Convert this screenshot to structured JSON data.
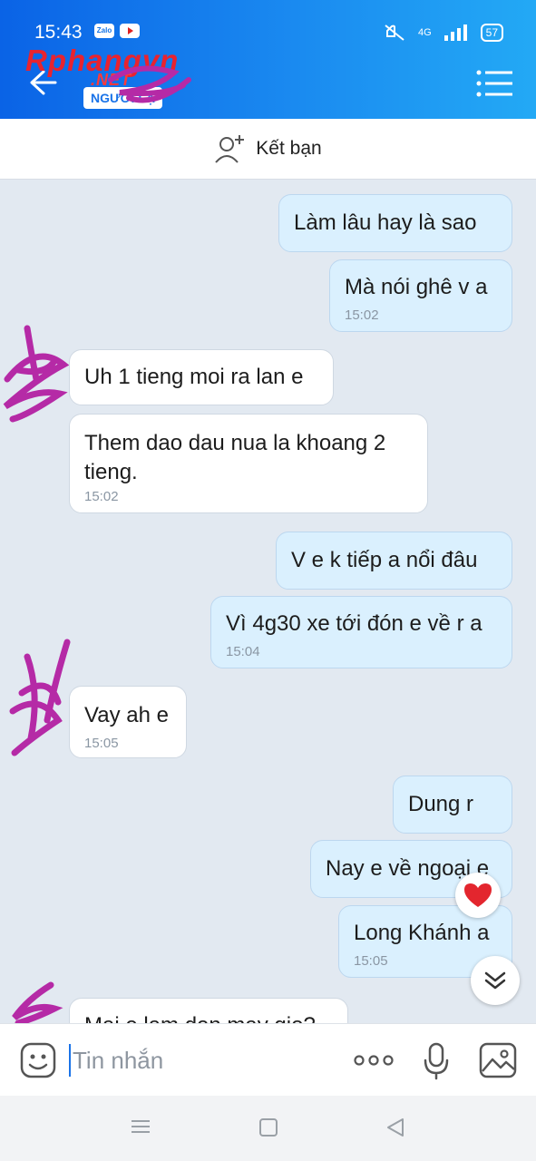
{
  "status": {
    "time": "15:43",
    "app1": "Zalo",
    "network": "4G",
    "battery": "57"
  },
  "header": {
    "brand": "Rphangvn",
    "brand_suffix": ".NET",
    "badge": "NGƯỜI LẠ"
  },
  "friend_bar": {
    "label": "Kết bạn"
  },
  "messages": [
    {
      "dir": "out",
      "text": "Làm lâu hay là sao",
      "time": ""
    },
    {
      "dir": "out",
      "text": "Mà nói ghê v a",
      "time": "15:02"
    },
    {
      "dir": "in",
      "text": "Uh 1 tieng moi ra lan e",
      "time": ""
    },
    {
      "dir": "in",
      "text": "Them dao dau nua la khoang 2 tieng.",
      "line1": "Them dao dau nua la khoang 2",
      "line2": "tieng.",
      "time": "15:02"
    },
    {
      "dir": "out",
      "text": "V e k tiếp a nổi đâu",
      "time": ""
    },
    {
      "dir": "out",
      "text": "Vì 4g30 xe tới đón e về r a",
      "time": "15:04"
    },
    {
      "dir": "in",
      "text": "Vay ah e",
      "time": "15:05"
    },
    {
      "dir": "out",
      "text": "Dung r",
      "time": ""
    },
    {
      "dir": "out",
      "text": "Nay e về ngoại e",
      "time": ""
    },
    {
      "dir": "out",
      "text": "Long Khánh a",
      "time": "15:05"
    },
    {
      "dir": "in",
      "text": "Mai e lam den may gio?",
      "time": ""
    }
  ],
  "input": {
    "placeholder": "Tin nhắn"
  },
  "icons": {
    "back": "back-arrow-icon",
    "menu": "menu-list-icon",
    "add_friend": "add-friend-icon",
    "emoji": "emoji-icon",
    "more": "more-dots-icon",
    "mic": "microphone-icon",
    "image": "image-icon",
    "heart": "heart-reaction-icon",
    "scroll_down": "scroll-down-icon"
  },
  "colors": {
    "header_start": "#0a63e6",
    "header_end": "#23a9f5",
    "outgoing_bubble": "#daf0fe",
    "chat_bg": "#e2e9f1",
    "accent": "#1a73e8"
  }
}
